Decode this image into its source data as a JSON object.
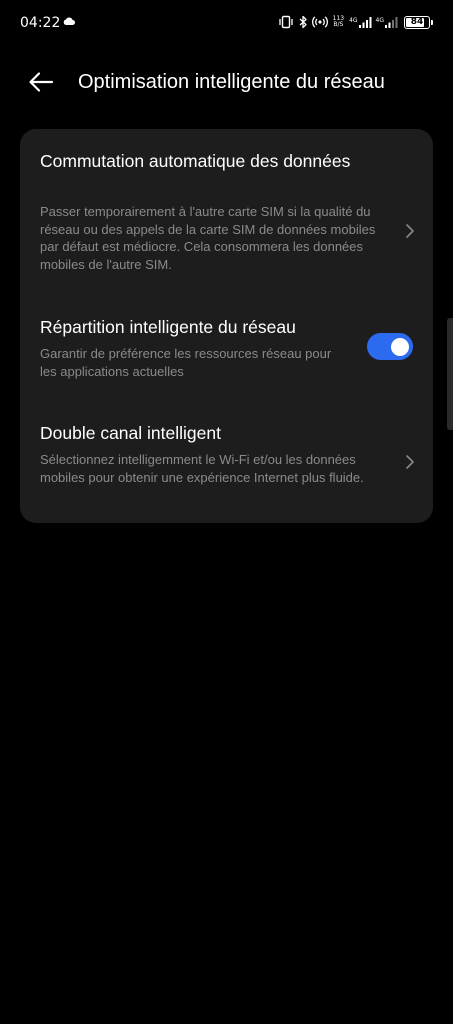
{
  "status_bar": {
    "time": "04:22",
    "net_speed_value": "113",
    "net_speed_unit": "B/S",
    "sim1_label": "4G",
    "sim2_label": "4G",
    "battery": "84",
    "battery_level": 0.84
  },
  "header": {
    "title": "Optimisation intelligente du réseau"
  },
  "items": [
    {
      "title": "Commutation automatique des données",
      "description": "Passer temporairement à l'autre carte SIM si la qualité du réseau ou des appels de la carte SIM de données mobiles par défaut est médiocre. Cela consommera les données mobiles de l'autre SIM."
    },
    {
      "title": "Répartition intelligente du réseau",
      "description": "Garantir de préférence les ressources réseau pour les applications actuelles",
      "toggle_on": true
    },
    {
      "title": "Double canal intelligent",
      "description": "Sélectionnez intelligemment le Wi-Fi et/ou les données mobiles pour obtenir une expérience Internet plus fluide."
    }
  ],
  "colors": {
    "background": "#000000",
    "card": "#1d1d1d",
    "toggle_accent": "#2c6bf0",
    "secondary_text": "#8a8a8a"
  }
}
